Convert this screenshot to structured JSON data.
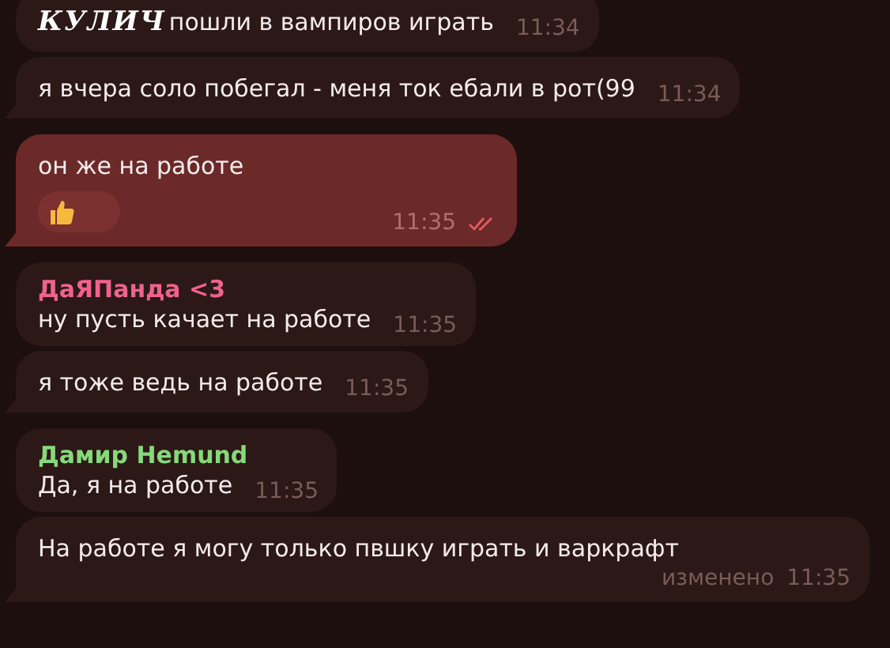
{
  "messages": [
    {
      "kind": "incoming",
      "group_end": false,
      "prefix": "КУЛИЧ",
      "text": "пошли в вампиров играть",
      "time": "11:34"
    },
    {
      "kind": "incoming",
      "group_end": true,
      "text": "я вчера соло побегал - меня ток ебали в рот(99",
      "time": "11:34"
    },
    {
      "kind": "outgoing",
      "group_end": true,
      "text": "он же на работе",
      "reaction": {
        "kind": "thumbs-up"
      },
      "time": "11:35",
      "read": true
    },
    {
      "kind": "incoming",
      "group_end": false,
      "sender": {
        "name": "ДаЯПанда <3",
        "color": "#f0628e"
      },
      "text": "ну пусть качает на работе",
      "time": "11:35"
    },
    {
      "kind": "incoming",
      "group_end": true,
      "text": "я тоже ведь на работе",
      "time": "11:35"
    },
    {
      "kind": "incoming",
      "group_end": false,
      "sender": {
        "name": "Дамир Hemund",
        "color": "#86d97a"
      },
      "text": "Да, я на работе",
      "time": "11:35"
    },
    {
      "kind": "incoming",
      "group_end": true,
      "text": "На работе я могу только пвшку играть и варкрафт",
      "edited": "изменено",
      "time": "11:35"
    }
  ]
}
